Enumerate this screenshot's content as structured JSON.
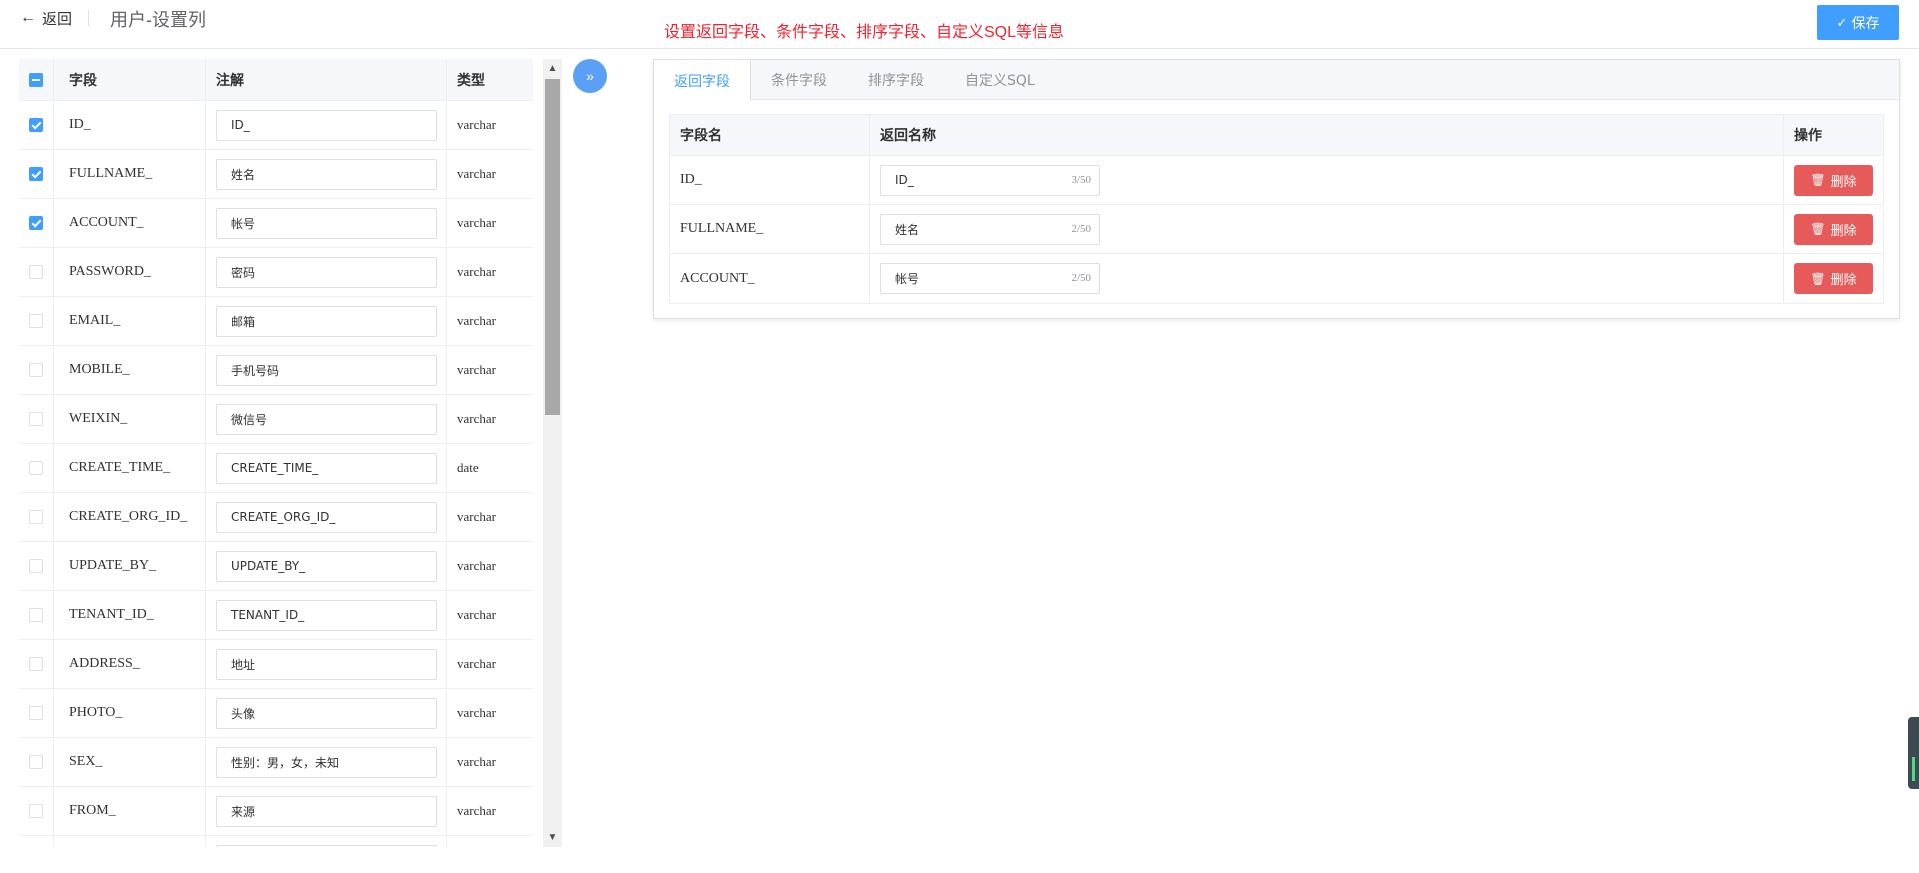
{
  "header": {
    "back_label": "返回",
    "title": "用户-设置列",
    "hint": "设置返回字段、条件字段、排序字段、自定义SQL等信息",
    "save_label": "保存"
  },
  "left_table": {
    "headers": {
      "field": "字段",
      "note": "注解",
      "type": "类型"
    },
    "rows": [
      {
        "field": "ID_",
        "note": "ID_",
        "type": "varchar",
        "checked": true
      },
      {
        "field": "FULLNAME_",
        "note": "姓名",
        "type": "varchar",
        "checked": true
      },
      {
        "field": "ACCOUNT_",
        "note": "帐号",
        "type": "varchar",
        "checked": true
      },
      {
        "field": "PASSWORD_",
        "note": "密码",
        "type": "varchar",
        "checked": false
      },
      {
        "field": "EMAIL_",
        "note": "邮箱",
        "type": "varchar",
        "checked": false
      },
      {
        "field": "MOBILE_",
        "note": "手机号码",
        "type": "varchar",
        "checked": false
      },
      {
        "field": "WEIXIN_",
        "note": "微信号",
        "type": "varchar",
        "checked": false
      },
      {
        "field": "CREATE_TIME_",
        "note": "CREATE_TIME_",
        "type": "date",
        "checked": false
      },
      {
        "field": "CREATE_ORG_ID_",
        "note": "CREATE_ORG_ID_",
        "type": "varchar",
        "checked": false
      },
      {
        "field": "UPDATE_BY_",
        "note": "UPDATE_BY_",
        "type": "varchar",
        "checked": false
      },
      {
        "field": "TENANT_ID_",
        "note": "TENANT_ID_",
        "type": "varchar",
        "checked": false
      },
      {
        "field": "ADDRESS_",
        "note": "地址",
        "type": "varchar",
        "checked": false
      },
      {
        "field": "PHOTO_",
        "note": "头像",
        "type": "varchar",
        "checked": false
      },
      {
        "field": "SEX_",
        "note": "性别：男，女，未知",
        "type": "varchar",
        "checked": false
      },
      {
        "field": "FROM_",
        "note": "来源",
        "type": "varchar",
        "checked": false
      },
      {
        "field": "",
        "note": "",
        "type": "",
        "checked": false
      }
    ]
  },
  "tabs": [
    {
      "label": "返回字段",
      "active": true
    },
    {
      "label": "条件字段",
      "active": false
    },
    {
      "label": "排序字段",
      "active": false
    },
    {
      "label": "自定义SQL",
      "active": false
    }
  ],
  "right_table": {
    "headers": {
      "name": "字段名",
      "ret": "返回名称",
      "op": "操作"
    },
    "rows": [
      {
        "name": "ID_",
        "ret": "ID_",
        "count": "3/50",
        "delete_label": "删除"
      },
      {
        "name": "FULLNAME_",
        "ret": "姓名",
        "count": "2/50",
        "delete_label": "删除"
      },
      {
        "name": "ACCOUNT_",
        "ret": "帐号",
        "count": "2/50",
        "delete_label": "删除"
      }
    ]
  },
  "icons": {
    "back": "arrow-left-icon",
    "save": "check-icon",
    "transfer": "double-chevron-right-icon",
    "delete": "trash-icon"
  },
  "colors": {
    "primary": "#409eff",
    "danger": "#e75a5a",
    "hint": "#f5222d"
  }
}
